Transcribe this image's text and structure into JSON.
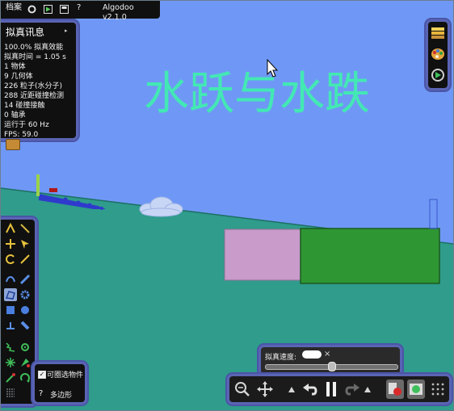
{
  "app": {
    "name": "Algodoo v2.1.0",
    "file_menu": "档案"
  },
  "scene": {
    "title": "水跃与水跌",
    "colors": {
      "sky": "#6f98f6",
      "ground": "#2f9c8c",
      "title": "#43e8b4",
      "pink_box": "#c89bcb",
      "green_box": "#2e9633",
      "water": "#2f3acc"
    }
  },
  "info_panel": {
    "title": "拟真讯息",
    "lines": [
      "100.0% 拟真效能",
      "拟真时间 = 1.05 s",
      "1 物体",
      "9 几何体",
      "226 粒子(水分子)",
      "288 近距碰撞检测",
      "14 碰撞接触",
      "0 轴承",
      "运行于 60 Hz",
      "FPS: 59.0"
    ]
  },
  "left_toolbar": {
    "tools": [
      "sketch-tool",
      "brush-tool",
      "move-tool",
      "drag-tool",
      "rotate-tool",
      "scale-tool",
      "rope-tool",
      "knife-tool",
      "polygon-tool",
      "gear-tool",
      "box-tool",
      "circle-tool",
      "plane-tool",
      "chain-tool",
      "spring-tool",
      "fixate-tool",
      "hinge-tool",
      "tracer-tool",
      "laser-tool",
      "thruster-tool",
      "eraser-tool"
    ],
    "selected_tool": "polygon-tool",
    "checkbox_label": "可圈选物件",
    "checkbox_checked": true,
    "help_glyph": "?",
    "current_tool_label": "多边形"
  },
  "sim_speed": {
    "label": "拟真速度:",
    "value_hidden": true,
    "close_glyph": "×",
    "slider_value": 0.5
  },
  "bottom_toolbar": {
    "buttons": [
      "zoom-icon",
      "pan-icon",
      "speed-up-icon",
      "undo-icon",
      "pause-icon",
      "redo-icon",
      "play-sim-icon",
      "record-icon",
      "grid-icon"
    ]
  },
  "right_toolbar": {
    "buttons": [
      "layers-icon",
      "palette-icon",
      "options-icon"
    ]
  }
}
